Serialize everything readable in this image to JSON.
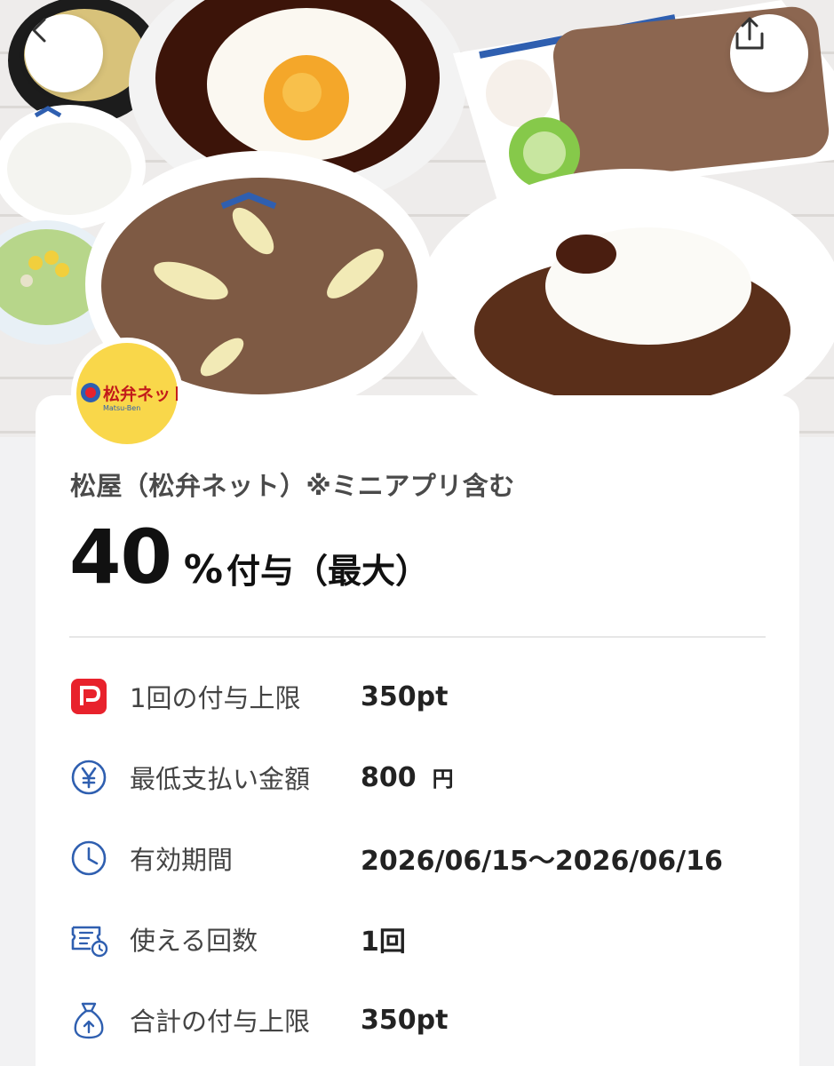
{
  "nav": {
    "back_icon": "chevron-left-icon",
    "share_icon": "share-icon"
  },
  "logo": {
    "brand_text": "松弁ネット",
    "sub_text": "Matsu-Ben"
  },
  "campaign": {
    "store_name": "松屋（松弁ネット）※ミニアプリ含む",
    "rate_value": "40",
    "rate_percent": "%",
    "rate_label": "付与（最大）"
  },
  "details": [
    {
      "icon": "paypay-icon",
      "label": "1回の付与上限",
      "value": "350pt",
      "unit": ""
    },
    {
      "icon": "yen-icon",
      "label": "最低支払い金額",
      "value": "800",
      "unit": "円"
    },
    {
      "icon": "clock-icon",
      "label": "有効期間",
      "value": "2026/06/15〜2026/06/16",
      "unit": ""
    },
    {
      "icon": "ticket-icon",
      "label": "使える回数",
      "value": "1回",
      "unit": ""
    },
    {
      "icon": "money-bag-icon",
      "label": "合計の付与上限",
      "value": "350pt",
      "unit": ""
    }
  ],
  "colors": {
    "accent_blue": "#2f5fb0",
    "paypay_red": "#e8222c",
    "logo_yellow": "#f9d74a"
  }
}
